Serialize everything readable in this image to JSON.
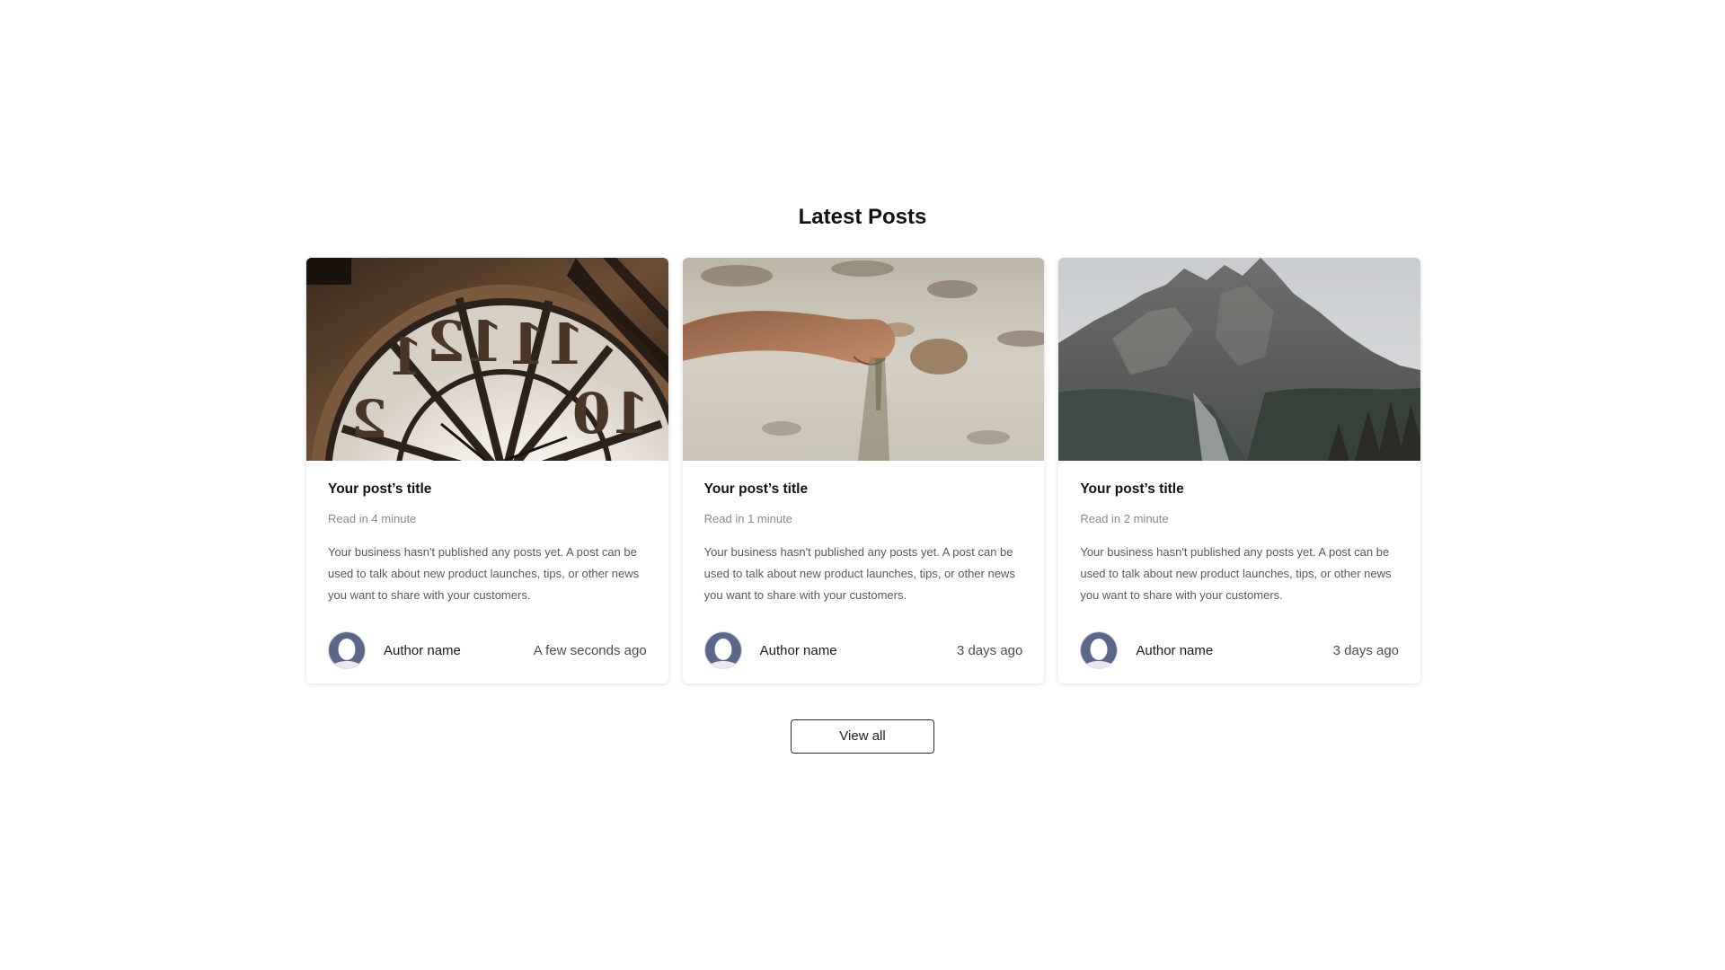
{
  "section": {
    "title": "Latest Posts"
  },
  "posts": [
    {
      "image_icon": "clock-photo",
      "title": "Your post’s title",
      "read_time": "Read in 4 minute",
      "excerpt": "Your business hasn't published any posts yet. A post can be used to talk about new product launches, tips, or other news you want to share with your customers.",
      "author_icon": "default-avatar-icon",
      "author": "Author name",
      "date": "A few seconds ago"
    },
    {
      "image_icon": "sand-hand-photo",
      "title": "Your post’s title",
      "read_time": "Read in 1 minute",
      "excerpt": "Your business hasn't published any posts yet. A post can be used to talk about new product launches, tips, or other news you want to share with your customers.",
      "author_icon": "default-avatar-icon",
      "author": "Author name",
      "date": "3 days ago"
    },
    {
      "image_icon": "mountain-photo",
      "title": "Your post’s title",
      "read_time": "Read in 2 minute",
      "excerpt": "Your business hasn't published any posts yet. A post can be used to talk about new product launches, tips, or other news you want to share with your customers.",
      "author_icon": "default-avatar-icon",
      "author": "Author name",
      "date": "3 days ago"
    }
  ],
  "actions": {
    "view_all_label": "View all"
  },
  "colors": {
    "background": "#ffffff",
    "text_primary": "#111111",
    "text_muted": "#8a8a8a",
    "avatar": "#5a6788"
  }
}
